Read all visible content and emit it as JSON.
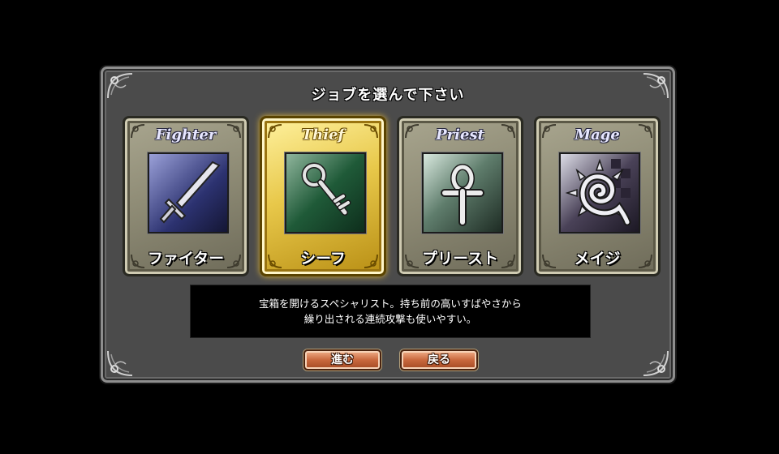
{
  "dialog": {
    "title": "ジョブを選んで下さい",
    "jobs": [
      {
        "en": "Fighter",
        "jp": "ファイター",
        "icon": "sword-icon",
        "selected": false
      },
      {
        "en": "Thief",
        "jp": "シーフ",
        "icon": "key-icon",
        "selected": true
      },
      {
        "en": "Priest",
        "jp": "プリースト",
        "icon": "ankh-icon",
        "selected": false
      },
      {
        "en": "Mage",
        "jp": "メイジ",
        "icon": "spiral-sun-icon",
        "selected": false
      }
    ],
    "description": {
      "line1": "宝箱を開けるスペシャリスト。持ち前の高いすばやさから",
      "line2": "繰り出される連続攻撃も使いやすい。"
    },
    "buttons": {
      "proceed": "進む",
      "back": "戻る"
    }
  },
  "colors": {
    "selected_frame": "#e8c84a",
    "frame": "#8f8c76",
    "button": "#c9683d",
    "panel": "#4b4b4b"
  }
}
